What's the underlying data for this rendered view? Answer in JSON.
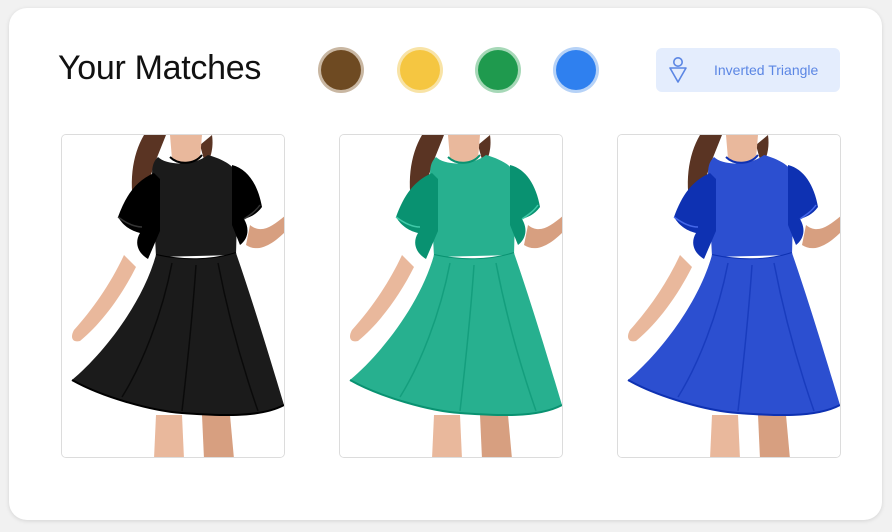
{
  "header": {
    "title": "Your Matches"
  },
  "color_filters": [
    {
      "name": "brown",
      "color": "#6e4a22",
      "ring": "#c9b7a2"
    },
    {
      "name": "yellow",
      "color": "#f5c641",
      "ring": "#f8e3a6"
    },
    {
      "name": "green",
      "color": "#1f9a4e",
      "ring": "#a6d8b7"
    },
    {
      "name": "blue",
      "color": "#2f80ef",
      "ring": "#b6d2f7"
    }
  ],
  "body_shape": {
    "label": "Inverted Triangle",
    "icon": "inverted-triangle-body-icon"
  },
  "products": [
    {
      "name": "black-ruffle-sleeve-dress",
      "dress_color": "#1b1b1b"
    },
    {
      "name": "teal-ruffle-sleeve-dress",
      "dress_color": "#27b08f"
    },
    {
      "name": "royal-blue-ruffle-sleeve-dress",
      "dress_color": "#2c4fd0"
    }
  ]
}
